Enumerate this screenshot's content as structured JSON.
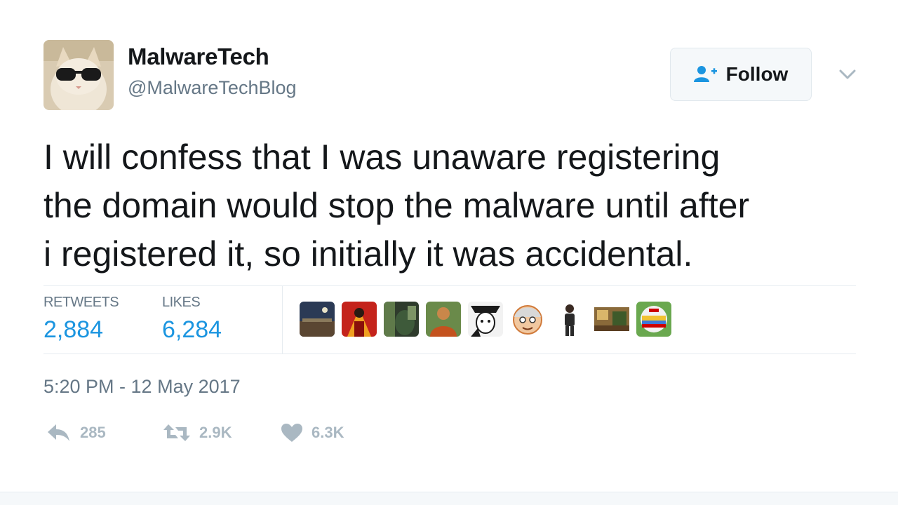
{
  "header": {
    "display_name": "MalwareTech",
    "screen_name": "@MalwareTechBlog",
    "follow_label": "Follow",
    "avatar_icon": "avatar-cat-sunglasses-icon",
    "chevron_icon": "chevron-down-icon"
  },
  "tweet": {
    "lines": [
      "I will confess that I was unaware registering",
      "the domain would stop the malware until after",
      "i registered it, so initially it was accidental."
    ]
  },
  "stats": {
    "retweets_label": "RETWEETS",
    "retweets_count": "2,884",
    "likes_label": "LIKES",
    "likes_count": "6,284"
  },
  "likers": [
    {
      "icon": "liker-avatar-night-sky-icon"
    },
    {
      "icon": "liker-avatar-red-figure-icon"
    },
    {
      "icon": "liker-avatar-green-dark-icon"
    },
    {
      "icon": "liker-avatar-person-orange-icon"
    },
    {
      "icon": "liker-avatar-sketch-face-icon"
    },
    {
      "icon": "liker-avatar-cartoon-face-icon"
    },
    {
      "icon": "liker-avatar-standing-person-icon"
    },
    {
      "icon": "liker-avatar-room-scene-icon"
    },
    {
      "icon": "liker-avatar-badge-icon"
    }
  ],
  "timestamp": "5:20 PM - 12 May 2017",
  "actions": {
    "reply_count": "285",
    "retweet_count": "2.9K",
    "like_count": "6.3K"
  },
  "colors": {
    "accent_blue": "#1b95e0",
    "muted_text": "#657786",
    "action_gray": "#aab8c2",
    "divider": "#e6ecf0"
  }
}
